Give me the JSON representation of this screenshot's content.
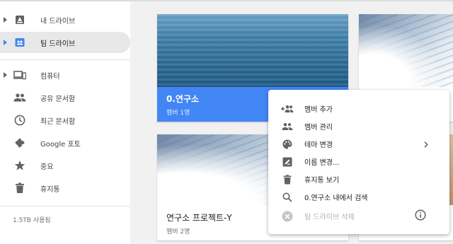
{
  "sidebar": {
    "items": [
      {
        "label": "내 드라이브"
      },
      {
        "label": "팀 드라이브"
      },
      {
        "label": "컴퓨터"
      },
      {
        "label": "공유 문서함"
      },
      {
        "label": "최근 문서함"
      },
      {
        "label": "Google 포토"
      },
      {
        "label": "중요"
      },
      {
        "label": "휴지통"
      }
    ],
    "storage": "1.5TB 사용됨"
  },
  "cards": [
    {
      "title": "0.연구소",
      "subtitle": "멤버 1명"
    },
    {
      "title": "연구소 프로젝트-Y",
      "subtitle": "멤버 2명"
    }
  ],
  "menu": {
    "items": [
      {
        "label": "멤버 추가"
      },
      {
        "label": "멤버 관리"
      },
      {
        "label": "테마 변경"
      },
      {
        "label": "이름 변경..."
      },
      {
        "label": "휴지통 보기"
      },
      {
        "label": "0.연구소 내에서 검색"
      },
      {
        "label": "팀 드라이브 삭제"
      }
    ]
  },
  "colors": {
    "selected_card": "#4285f4",
    "active_nav_bg": "#e8e8e8",
    "menu_icon": "#5f6368",
    "disabled": "#b0b0b0"
  }
}
